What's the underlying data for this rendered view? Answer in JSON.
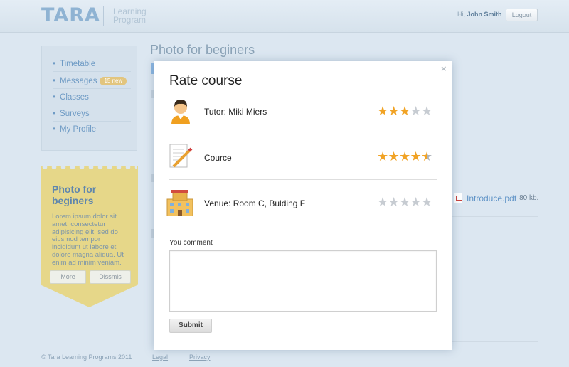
{
  "header": {
    "logo": "TARA",
    "logo_sub": "Learning Program",
    "greeting": "Hi,",
    "user_name": "John Smith",
    "logout_label": "Logout"
  },
  "sidebar": {
    "items": [
      {
        "label": "Timetable"
      },
      {
        "label": "Messages",
        "badge": "15 new"
      },
      {
        "label": "Classes"
      },
      {
        "label": "Surveys"
      },
      {
        "label": "My Profile"
      }
    ]
  },
  "promo": {
    "title": "Photo for beginers",
    "text": "Lorem ipsum dolor sit amet, consectetur adipisicing elit, sed do eiusmod tempor incididunt ut labore et dolore magna aliqua. Ut enim ad minim veniam.",
    "more_label": "More",
    "dismiss_label": "Dissmis"
  },
  "main": {
    "title": "Photo for beginers",
    "attachment": {
      "name": "Introduce.pdf",
      "size": "80 kb."
    }
  },
  "footer": {
    "copyright": "© Tara Learning Programs 2011",
    "legal": "Legal",
    "privacy": "Privacy"
  },
  "modal": {
    "close": "×",
    "title": "Rate course",
    "rows": [
      {
        "label": "Tutor: Miki Miers",
        "icon": "user-avatar-icon",
        "rating": 3,
        "max": 5
      },
      {
        "label": "Cource",
        "icon": "document-pencil-icon",
        "rating": 4.5,
        "max": 5
      },
      {
        "label": "Venue: Room C, Bulding F",
        "icon": "building-icon",
        "rating": 0,
        "max": 5
      }
    ],
    "comment_label": "You comment",
    "comment_value": "",
    "submit_label": "Submit"
  },
  "colors": {
    "background": "#dce7f1",
    "accent": "#6f9bc5",
    "star_on": "#f1a325",
    "star_off": "#c7ccd2",
    "promo": "#e6d789"
  }
}
